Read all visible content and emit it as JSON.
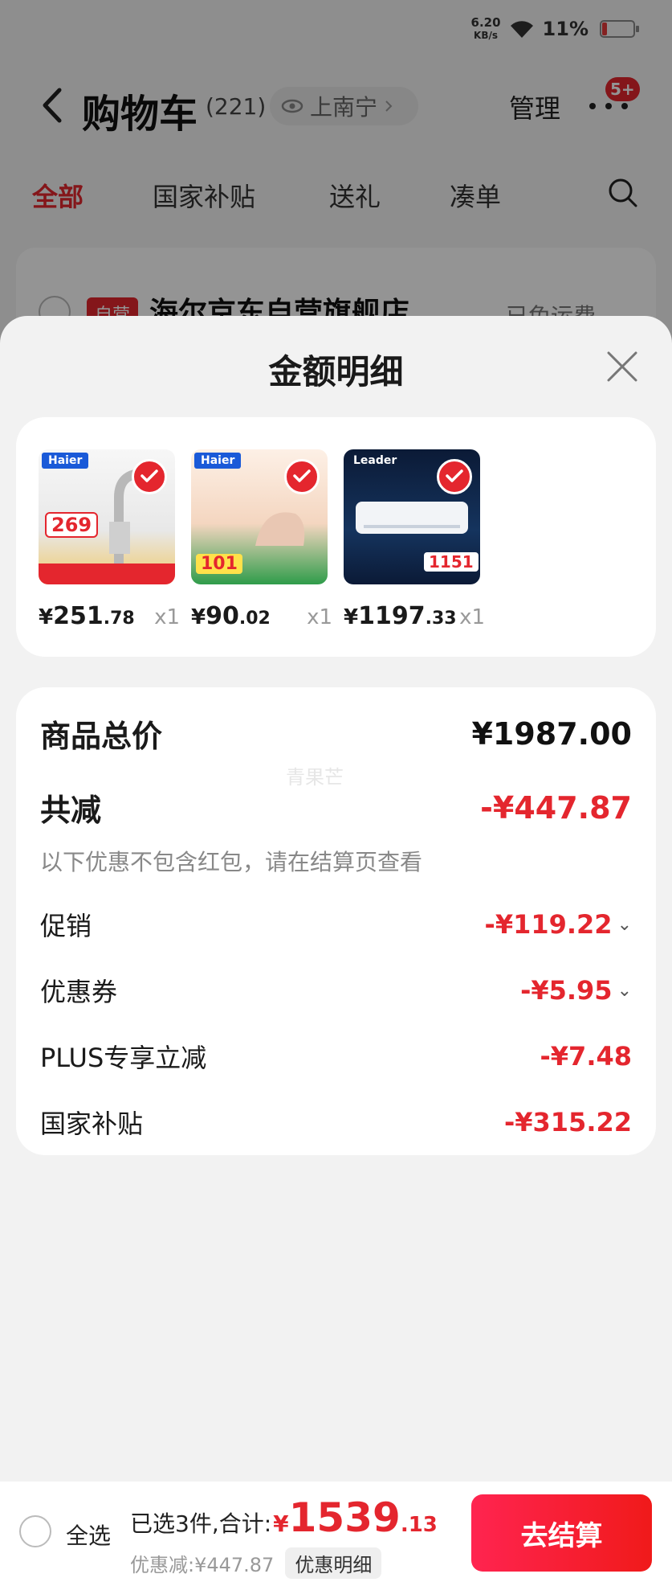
{
  "status_bar": {
    "net_speed_value": "6.20",
    "net_speed_unit": "KB/s",
    "battery": "11%"
  },
  "header": {
    "title": "购物车",
    "count": "(221)",
    "location": "上南宁",
    "manage": "管理",
    "badge": "5+"
  },
  "tabs": [
    {
      "label": "全部",
      "active": true
    },
    {
      "label": "国家补贴",
      "active": false
    },
    {
      "label": "送礼",
      "active": false
    },
    {
      "label": "凑单",
      "active": false
    }
  ],
  "store": {
    "tag": "自营",
    "name": "海尔京东自营旗舰店",
    "shipping": "已免运费"
  },
  "sheet": {
    "title": "金额明细"
  },
  "products": [
    {
      "brand": "Haier",
      "promo_price": "269",
      "price_int": "251",
      "price_dec": ".78",
      "qty": "x1"
    },
    {
      "brand": "Haier",
      "promo_price": "101",
      "price_int": "90",
      "price_dec": ".02",
      "qty": "x1"
    },
    {
      "brand": "Leader",
      "promo_price": "1151",
      "price_int": "1197",
      "price_dec": ".33",
      "qty": "x1"
    }
  ],
  "currency": "¥",
  "details": {
    "watermark": "青果芒",
    "total_label": "商品总价",
    "total_value": "¥1987.00",
    "reduce_label": "共减",
    "reduce_value": "-¥447.87",
    "note": "以下优惠不包含红包，请在结算页查看",
    "items": [
      {
        "label": "促销",
        "value": "-¥119.22",
        "expandable": true
      },
      {
        "label": "优惠券",
        "value": "-¥5.95",
        "expandable": true
      },
      {
        "label": "PLUS专享立减",
        "value": "-¥7.48",
        "expandable": false
      },
      {
        "label": "国家补贴",
        "value": "-¥315.22",
        "expandable": false
      }
    ]
  },
  "bottom": {
    "select_all": "全选",
    "summary": "已选3件,合计:",
    "total_yen": "¥",
    "total_int": "1539",
    "total_dec": ".13",
    "discount": "优惠减:¥447.87",
    "detail_chip": "优惠明细",
    "checkout": "去结算"
  },
  "colors": {
    "accent": "#e4262e",
    "checkout_start": "#ff2450",
    "checkout_end": "#f01a1a"
  }
}
